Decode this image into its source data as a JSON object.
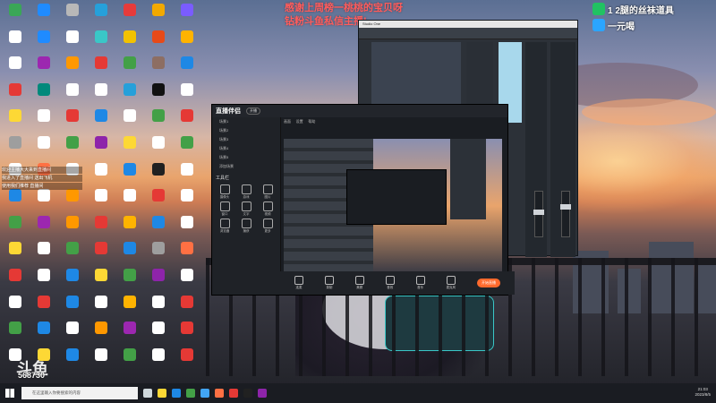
{
  "banner": {
    "line1": "感谢上周榜一桃桃的宝贝呀",
    "line2": "钻粉斗鱼私信主播!"
  },
  "side_badges": [
    {
      "icon": "wechat-icon",
      "text": "1 2腿的丝袜道具",
      "color": "#21c262"
    },
    {
      "icon": "qq-icon",
      "text": "一元喝",
      "color": "#2aa5ff"
    }
  ],
  "chat_lines": [
    "欢迎主播大大来到直播间",
    "我进入了直播间  送出飞机",
    "使用我们推荐  直播间"
  ],
  "desktop_icons": [
    {
      "label": "",
      "color": "#3aa757"
    },
    {
      "label": "",
      "color": "#1f8bff"
    },
    {
      "label": "",
      "color": "#b8b8b8"
    },
    {
      "label": "",
      "color": "#26a0da"
    },
    {
      "label": "",
      "color": "#e63b3b"
    },
    {
      "label": "",
      "color": "#f2a900"
    },
    {
      "label": "",
      "color": "#7a5cff"
    },
    {
      "label": "",
      "color": "#ffffff"
    },
    {
      "label": "",
      "color": "#1f8bff"
    },
    {
      "label": "",
      "color": "#ffffff"
    },
    {
      "label": "",
      "color": "#3ac7c7"
    },
    {
      "label": "",
      "color": "#f2c200"
    },
    {
      "label": "",
      "color": "#e64a19"
    },
    {
      "label": "",
      "color": "#ffb300"
    },
    {
      "label": "",
      "color": "#ffffff"
    },
    {
      "label": "",
      "color": "#9c27b0"
    },
    {
      "label": "",
      "color": "#ff9800"
    },
    {
      "label": "",
      "color": "#e53935"
    },
    {
      "label": "",
      "color": "#43a047"
    },
    {
      "label": "",
      "color": "#8d6e63"
    },
    {
      "label": "",
      "color": "#1e88e5"
    },
    {
      "label": "",
      "color": "#e53935"
    },
    {
      "label": "",
      "color": "#00897b"
    },
    {
      "label": "",
      "color": "#ffffff"
    },
    {
      "label": "",
      "color": "#ffffff"
    },
    {
      "label": "",
      "color": "#26a0da"
    },
    {
      "label": "",
      "color": "#111111"
    },
    {
      "label": "",
      "color": "#ffffff"
    },
    {
      "label": "",
      "color": "#fdd835"
    },
    {
      "label": "",
      "color": "#ffffff"
    },
    {
      "label": "",
      "color": "#e53935"
    },
    {
      "label": "",
      "color": "#1e88e5"
    },
    {
      "label": "",
      "color": "#ffffff"
    },
    {
      "label": "",
      "color": "#43a047"
    },
    {
      "label": "",
      "color": "#e53935"
    },
    {
      "label": "",
      "color": "#9e9e9e"
    },
    {
      "label": "",
      "color": "#ffffff"
    },
    {
      "label": "",
      "color": "#43a047"
    },
    {
      "label": "",
      "color": "#8e24aa"
    },
    {
      "label": "",
      "color": "#fdd835"
    },
    {
      "label": "",
      "color": "#ffffff"
    },
    {
      "label": "",
      "color": "#43a047"
    },
    {
      "label": "",
      "color": "#ffffff"
    },
    {
      "label": "",
      "color": "#ff7043"
    },
    {
      "label": "",
      "color": "#ffffff"
    },
    {
      "label": "",
      "color": "#ffffff"
    },
    {
      "label": "",
      "color": "#1e88e5"
    },
    {
      "label": "",
      "color": "#212121"
    },
    {
      "label": "",
      "color": "#ffffff"
    },
    {
      "label": "",
      "color": "#1e88e5"
    },
    {
      "label": "",
      "color": "#ffffff"
    },
    {
      "label": "",
      "color": "#ff9800"
    },
    {
      "label": "",
      "color": "#ffffff"
    },
    {
      "label": "",
      "color": "#ffffff"
    },
    {
      "label": "",
      "color": "#e53935"
    },
    {
      "label": "",
      "color": "#ffffff"
    },
    {
      "label": "",
      "color": "#43a047"
    },
    {
      "label": "",
      "color": "#9c27b0"
    },
    {
      "label": "",
      "color": "#ff9800"
    },
    {
      "label": "",
      "color": "#e53935"
    },
    {
      "label": "",
      "color": "#ffb300"
    },
    {
      "label": "",
      "color": "#1e88e5"
    },
    {
      "label": "",
      "color": "#ffffff"
    },
    {
      "label": "",
      "color": "#fdd835"
    },
    {
      "label": "",
      "color": "#ffffff"
    },
    {
      "label": "",
      "color": "#43a047"
    },
    {
      "label": "",
      "color": "#e53935"
    },
    {
      "label": "",
      "color": "#1e88e5"
    },
    {
      "label": "",
      "color": "#9e9e9e"
    },
    {
      "label": "",
      "color": "#ff7043"
    },
    {
      "label": "",
      "color": "#e53935"
    },
    {
      "label": "",
      "color": "#ffffff"
    },
    {
      "label": "",
      "color": "#1e88e5"
    },
    {
      "label": "",
      "color": "#fdd835"
    },
    {
      "label": "",
      "color": "#43a047"
    },
    {
      "label": "",
      "color": "#8e24aa"
    },
    {
      "label": "",
      "color": "#ffffff"
    },
    {
      "label": "",
      "color": "#ffffff"
    },
    {
      "label": "",
      "color": "#e53935"
    },
    {
      "label": "",
      "color": "#1e88e5"
    },
    {
      "label": "",
      "color": "#ffffff"
    },
    {
      "label": "",
      "color": "#ffb300"
    },
    {
      "label": "",
      "color": "#ffffff"
    },
    {
      "label": "",
      "color": "#e53935"
    },
    {
      "label": "",
      "color": "#43a047"
    },
    {
      "label": "",
      "color": "#1e88e5"
    },
    {
      "label": "",
      "color": "#ffffff"
    },
    {
      "label": "",
      "color": "#ff9800"
    },
    {
      "label": "",
      "color": "#9c27b0"
    },
    {
      "label": "",
      "color": "#ffffff"
    },
    {
      "label": "",
      "color": "#e53935"
    },
    {
      "label": "",
      "color": "#ffffff"
    },
    {
      "label": "",
      "color": "#fdd835"
    },
    {
      "label": "",
      "color": "#1e88e5"
    },
    {
      "label": "",
      "color": "#ffffff"
    },
    {
      "label": "",
      "color": "#43a047"
    },
    {
      "label": "",
      "color": "#ffffff"
    },
    {
      "label": "",
      "color": "#e53935"
    }
  ],
  "obs": {
    "app_name": "直播伴侣",
    "top_pill": "开播",
    "scenes": [
      "场景1",
      "场景2",
      "场景3",
      "场景4",
      "场景5",
      "添加场景"
    ],
    "tools_title": "工具栏",
    "tools": [
      "摄像头",
      "游戏",
      "图片",
      "窗口",
      "文字",
      "视频",
      "浏览器",
      "捕获",
      "更多"
    ],
    "bottom_buttons": [
      "连麦",
      "录制",
      "美颜",
      "音效",
      "音乐",
      "麦克风"
    ],
    "live_button": "开始直播",
    "preview_header": [
      "画面",
      "设置",
      "帮助"
    ]
  },
  "daw": {
    "title": "Studio One"
  },
  "taskbar": {
    "search_placeholder": "在这里输入你要搜索的内容",
    "apps": [
      {
        "icon": "task-view-icon",
        "color": "#cfd8dc"
      },
      {
        "icon": "folder-icon",
        "color": "#fdd835"
      },
      {
        "icon": "edge-icon",
        "color": "#1e88e5"
      },
      {
        "icon": "chrome-icon",
        "color": "#43a047"
      },
      {
        "icon": "store-icon",
        "color": "#42a5f5"
      },
      {
        "icon": "live-icon",
        "color": "#ff7043"
      },
      {
        "icon": "music-icon",
        "color": "#e53935"
      },
      {
        "icon": "obs-icon",
        "color": "#212121"
      },
      {
        "icon": "app-icon",
        "color": "#8e24aa"
      }
    ],
    "time": "21:03",
    "date": "2023/8/5"
  },
  "counter": {
    "logo": "斗鱼",
    "value": "568730"
  }
}
